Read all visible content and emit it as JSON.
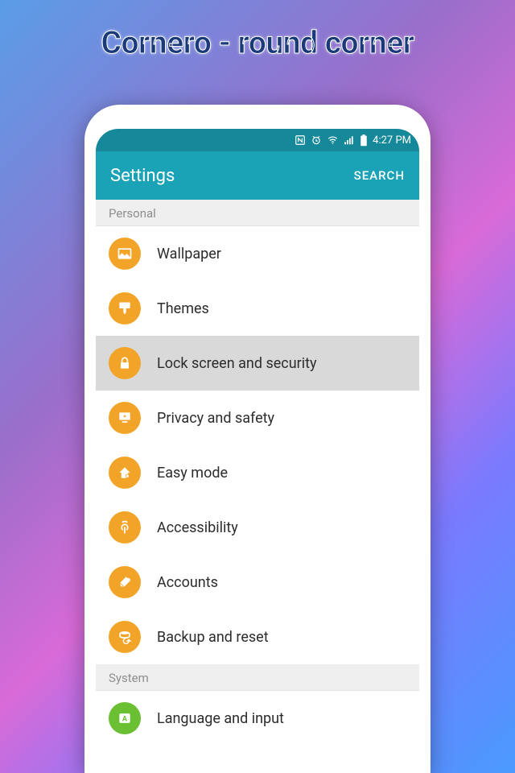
{
  "promo": {
    "title": "Cornero - round corner"
  },
  "status_bar": {
    "time": "4:27 PM"
  },
  "app_bar": {
    "title": "Settings",
    "search": "SEARCH"
  },
  "sections": {
    "personal": "Personal",
    "system": "System"
  },
  "items": [
    {
      "label": "Wallpaper"
    },
    {
      "label": "Themes"
    },
    {
      "label": "Lock screen and security"
    },
    {
      "label": "Privacy and safety"
    },
    {
      "label": "Easy mode"
    },
    {
      "label": "Accessibility"
    },
    {
      "label": "Accounts"
    },
    {
      "label": "Backup and reset"
    },
    {
      "label": "Language and input"
    }
  ]
}
